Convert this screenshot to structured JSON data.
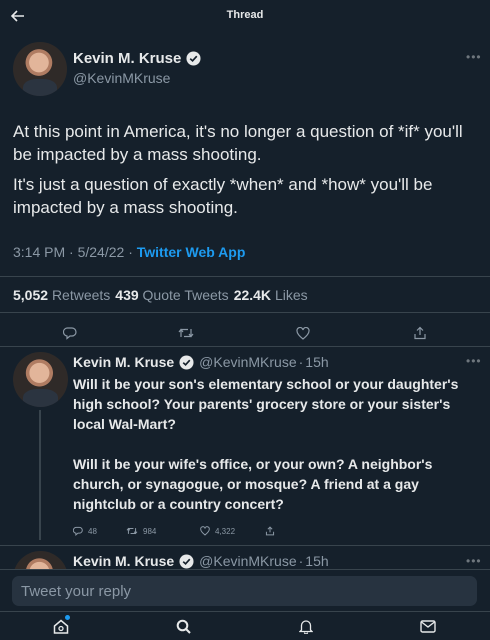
{
  "header": {
    "title": "Thread"
  },
  "main_tweet": {
    "name": "Kevin M. Kruse",
    "handle": "@KevinMKruse",
    "paragraphs": [
      "At this point in America, it's no longer a question of *if* you'll be impacted by a mass shooting.",
      "It's just a question of exactly *when* and *how* you'll be impacted by a mass shooting."
    ],
    "time": "3:14 PM",
    "date": "5/24/22",
    "separator": "·",
    "app": "Twitter Web App",
    "retweets_count": "5,052",
    "retweets_label": "Retweets",
    "quotes_count": "439",
    "quotes_label": "Quote Tweets",
    "likes_count": "22.4K",
    "likes_label": "Likes"
  },
  "reply1": {
    "name": "Kevin M. Kruse",
    "handle": "@KevinMKruse",
    "separator": "·",
    "age": "15h",
    "text": "Will it be your son's elementary school or your daughter's high school? Your parents' grocery store or your sister's local Wal-Mart?\n\nWill it be your wife's office, or your own? A neighbor's church, or synagogue, or mosque? A friend at a gay nightclub or a country concert?",
    "reply_count": "48",
    "retweet_count": "984",
    "like_count": "4,322"
  },
  "reply2": {
    "name": "Kevin M. Kruse",
    "handle": "@KevinMKruse",
    "separator": "·",
    "age": "15h"
  },
  "reply_box": {
    "placeholder": "Tweet your reply"
  },
  "colors": {
    "background": "#15202b",
    "accent": "#1d9bf0",
    "muted": "#8b98a5",
    "border": "#38444d"
  },
  "icons": [
    "back-arrow-icon",
    "verified-badge-icon",
    "more-icon",
    "reply-icon",
    "retweet-icon",
    "like-icon",
    "share-icon",
    "home-icon",
    "search-icon",
    "notifications-icon",
    "messages-icon"
  ]
}
